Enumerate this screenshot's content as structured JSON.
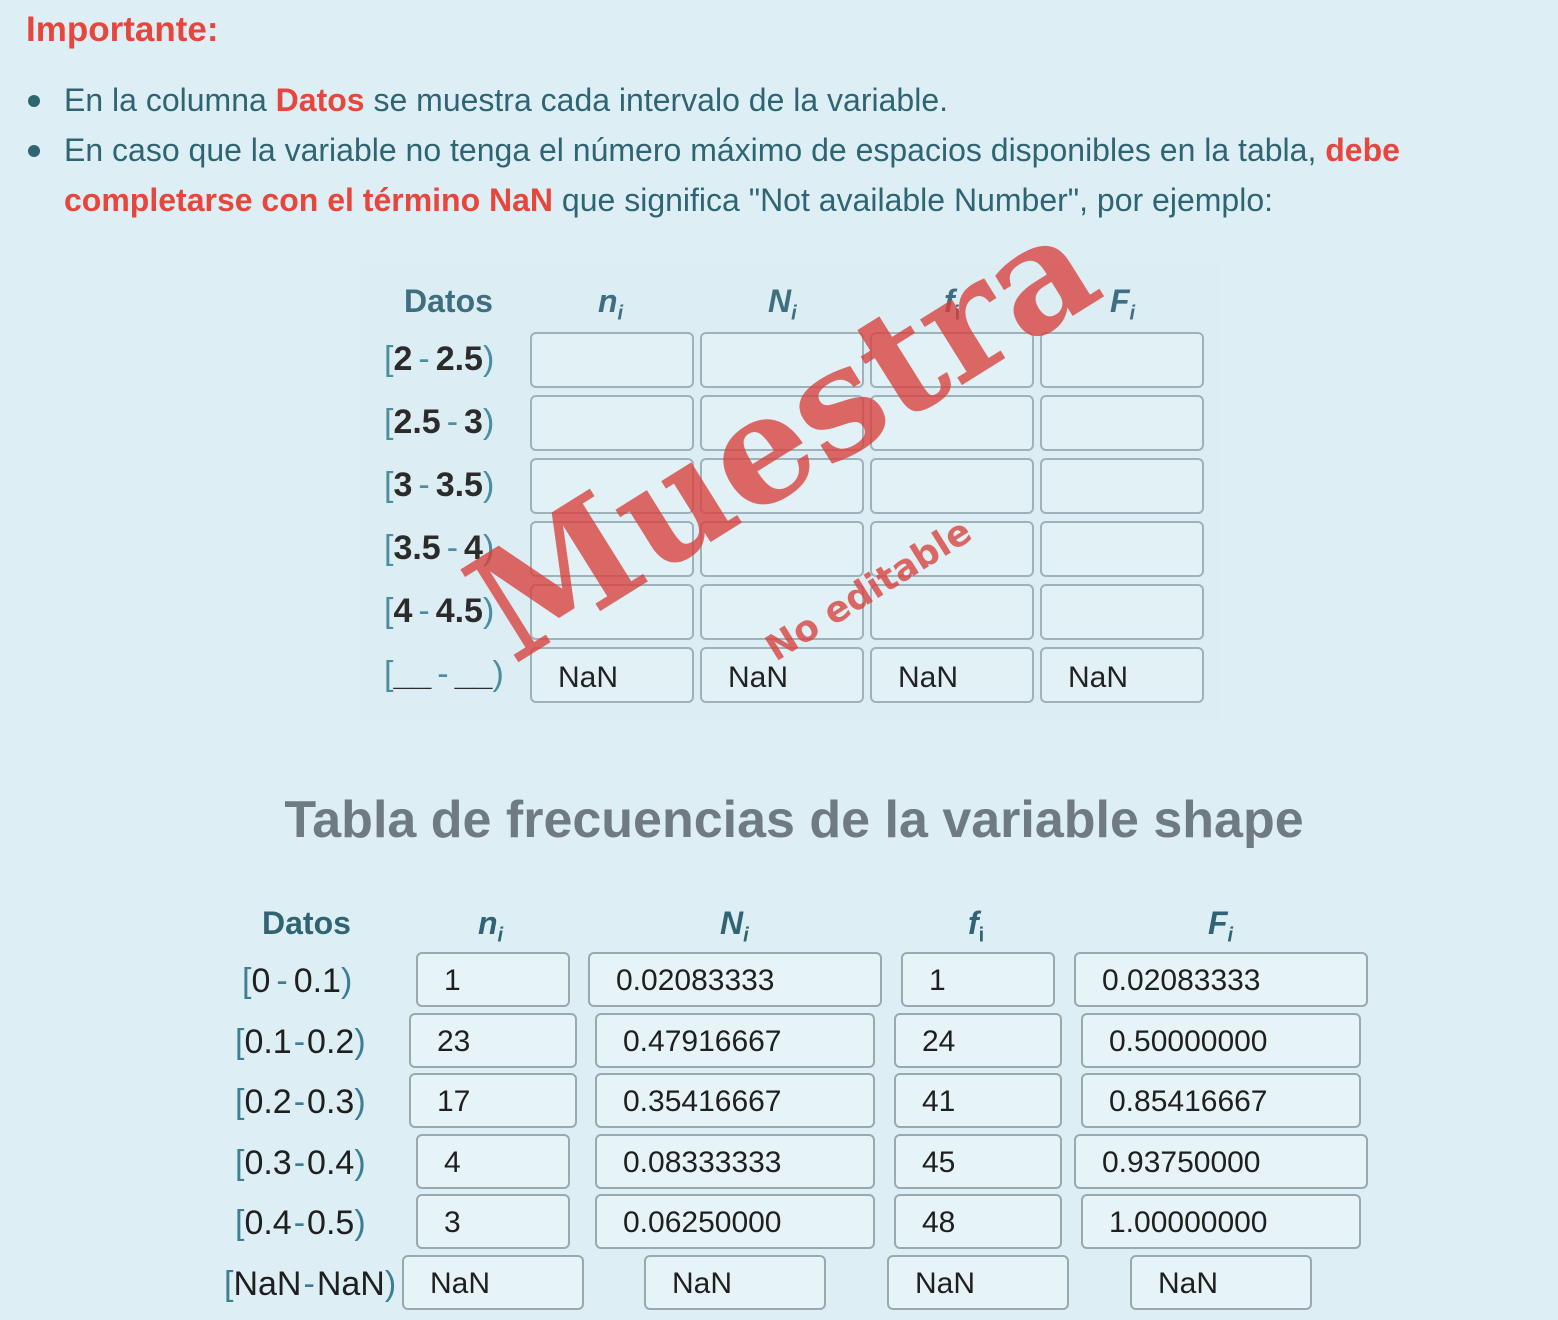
{
  "important": {
    "title": "Importante:",
    "bullet1": {
      "pre": "En la columna ",
      "highlight": "Datos",
      "post": " se muestra cada intervalo de la variable."
    },
    "bullet2": {
      "line1_pre": "En caso que la variable no tenga el número máximo de espacios disponibles en la tabla, ",
      "line1_highlight": "debe",
      "line2_highlight": "completarse con el término NaN",
      "line2_post": " que significa \"Not available Number\", por ejemplo:"
    }
  },
  "sample_table": {
    "headers": {
      "datos": "Datos",
      "ni": "n",
      "Ni": "N",
      "fi": "f",
      "Fi": "F",
      "sub": "i"
    },
    "rows": [
      {
        "a": "2",
        "b": "2.5",
        "values": [
          "",
          "",
          "",
          ""
        ]
      },
      {
        "a": "2.5",
        "b": "3",
        "values": [
          "",
          "",
          "",
          ""
        ]
      },
      {
        "a": "3",
        "b": "3.5",
        "values": [
          "",
          "",
          "",
          ""
        ]
      },
      {
        "a": "3.5",
        "b": "4",
        "values": [
          "",
          "",
          "",
          ""
        ]
      },
      {
        "a": "4",
        "b": "4.5",
        "values": [
          "",
          "",
          "",
          ""
        ]
      },
      {
        "a": "__",
        "b": "__",
        "values": [
          "NaN",
          "NaN",
          "NaN",
          "NaN"
        ]
      }
    ],
    "watermark_main": "Muestra",
    "watermark_sub": "No editable",
    "watermark_color": "#d9403c"
  },
  "section_title": "Tabla de frecuencias de la variable shape",
  "freq_table": {
    "headers": {
      "datos": "Datos",
      "ni": "n",
      "Ni": "N",
      "fi": "f",
      "Fi": "F",
      "sub": "i"
    },
    "rows": [
      {
        "a": "0",
        "b": "0.1",
        "ni": "1",
        "Ni": "0.02083333",
        "fi": "1",
        "Fi": "0.02083333"
      },
      {
        "a": "0.1",
        "b": "0.2",
        "ni": "23",
        "Ni": "0.47916667",
        "fi": "24",
        "Fi": "0.50000000"
      },
      {
        "a": "0.2",
        "b": "0.3",
        "ni": "17",
        "Ni": "0.35416667",
        "fi": "41",
        "Fi": "0.85416667"
      },
      {
        "a": "0.3",
        "b": "0.4",
        "ni": "4",
        "Ni": "0.08333333",
        "fi": "45",
        "Fi": "0.93750000"
      },
      {
        "a": "0.4",
        "b": "0.5",
        "ni": "3",
        "Ni": "0.06250000",
        "fi": "48",
        "Fi": "1.00000000"
      },
      {
        "a": "NaN",
        "b": "NaN",
        "ni": "NaN",
        "Ni": "NaN",
        "fi": "NaN",
        "Fi": "NaN"
      }
    ]
  }
}
